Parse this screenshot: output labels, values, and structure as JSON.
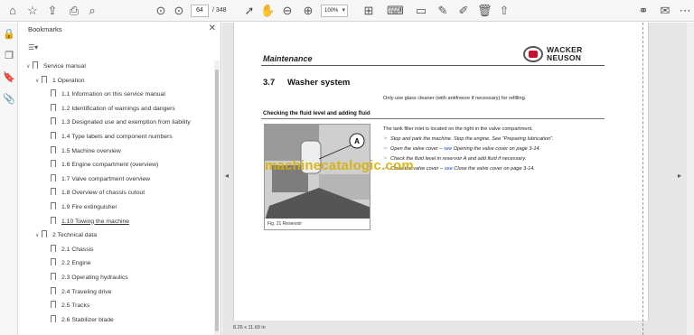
{
  "toolbar": {
    "current_page": "64",
    "total_pages": "/ 348",
    "zoom": "100%",
    "icons": [
      "home-icon",
      "star-icon",
      "upload-icon",
      "print-icon",
      "search-icon",
      "page-up-icon",
      "page-down-icon",
      "select-icon",
      "hand-icon",
      "zoom-out-icon",
      "zoom-in-icon",
      "fit-page-icon",
      "keyboard-icon",
      "comment-icon",
      "pen-icon",
      "stamp-icon",
      "delete-icon",
      "share-icon",
      "link-icon",
      "mail-icon"
    ]
  },
  "bookmarks": {
    "title": "Bookmarks",
    "items": [
      {
        "label": "Service manual",
        "level": 0,
        "twisty": "∨"
      },
      {
        "label": "1 Operation",
        "level": 1,
        "twisty": "∨"
      },
      {
        "label": "1.1 Information on this service manual",
        "level": 2
      },
      {
        "label": "1.2 Identification of warnings and dangers",
        "level": 2
      },
      {
        "label": "1.3 Designated use and exemption from liability",
        "level": 2
      },
      {
        "label": "1.4 Type labels and component numbers",
        "level": 2
      },
      {
        "label": "1.5 Machine overview",
        "level": 2
      },
      {
        "label": "1.6 Engine compartment (overview)",
        "level": 2
      },
      {
        "label": "1.7 Valve compartment overview",
        "level": 2
      },
      {
        "label": "1.8 Overview of chassis cutout",
        "level": 2
      },
      {
        "label": "1.9 Fire extinguisher",
        "level": 2
      },
      {
        "label": "1.10 Towing the machine",
        "level": 2,
        "underlined": true
      },
      {
        "label": "2 Technical data",
        "level": 1,
        "twisty": "∨"
      },
      {
        "label": "2.1 Chassis",
        "level": 2
      },
      {
        "label": "2.2 Engine",
        "level": 2
      },
      {
        "label": "2.3 Operating hydraulics",
        "level": 2
      },
      {
        "label": "2.4 Traveling drive",
        "level": 2
      },
      {
        "label": "2.5 Tracks",
        "level": 2
      },
      {
        "label": "2.6 Stabilizer blade",
        "level": 2
      }
    ]
  },
  "page": {
    "header": "Maintenance",
    "logo_line1": "WACKER",
    "logo_line2": "NEUSON",
    "section_num": "3.7",
    "section_title": "Washer system",
    "intro": "Only use glass cleaner (with antifreeze if necessary) for refilling.",
    "subhead": "Checking the fluid level and adding fluid",
    "fig_caption": "Fig. 21   Reservoir",
    "fig_label": "A",
    "step_intro": "The tank filler inlet is located on the right in the valve compartment.",
    "step1": "Stop and park the machine. Stop the engine. See \"Preparing lubrication\".",
    "step2_pre": "Open the valve cover – ",
    "step2_link": "see",
    "step2_post": " Opening the valve cover on page 3-14.",
    "step3": "Check the fluid level in reservoir A and add fluid if necessary.",
    "step4_pre": "Close the valve cover – ",
    "step4_link": "see",
    "step4_post": " Close the valve cover on page 3-14.",
    "watermark": "machinecatalogic.com",
    "page_size": "8.26 x 11.69 in"
  },
  "colors": {
    "link": "#1c49c7",
    "logo_red": "#c8102e",
    "watermark": "#d8b000"
  }
}
